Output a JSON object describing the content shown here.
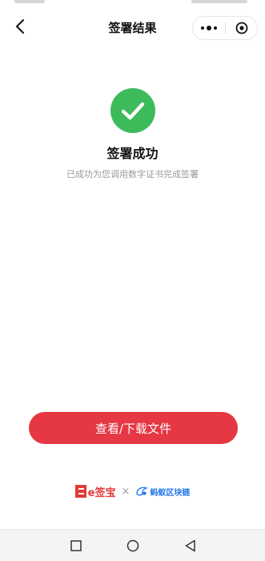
{
  "header": {
    "title": "签署结果"
  },
  "result": {
    "title": "签署成功",
    "description": "已成功为您调用数字证书完成签署"
  },
  "actions": {
    "primary_label": "查看/下载文件"
  },
  "branding": {
    "esign": "e签宝",
    "separator": "×",
    "partner": "蚂蚁区块链"
  },
  "colors": {
    "success": "#3dbb5b",
    "primary": "#e53744",
    "esign_brand": "#e23a3a",
    "chain_brand": "#1a73e8"
  },
  "icons": {
    "back": "back-chevron-icon",
    "more": "more-dots-icon",
    "close": "target-close-icon",
    "success": "check-circle-icon",
    "nav_recent": "square-icon",
    "nav_home": "circle-icon",
    "nav_back": "triangle-back-icon"
  }
}
